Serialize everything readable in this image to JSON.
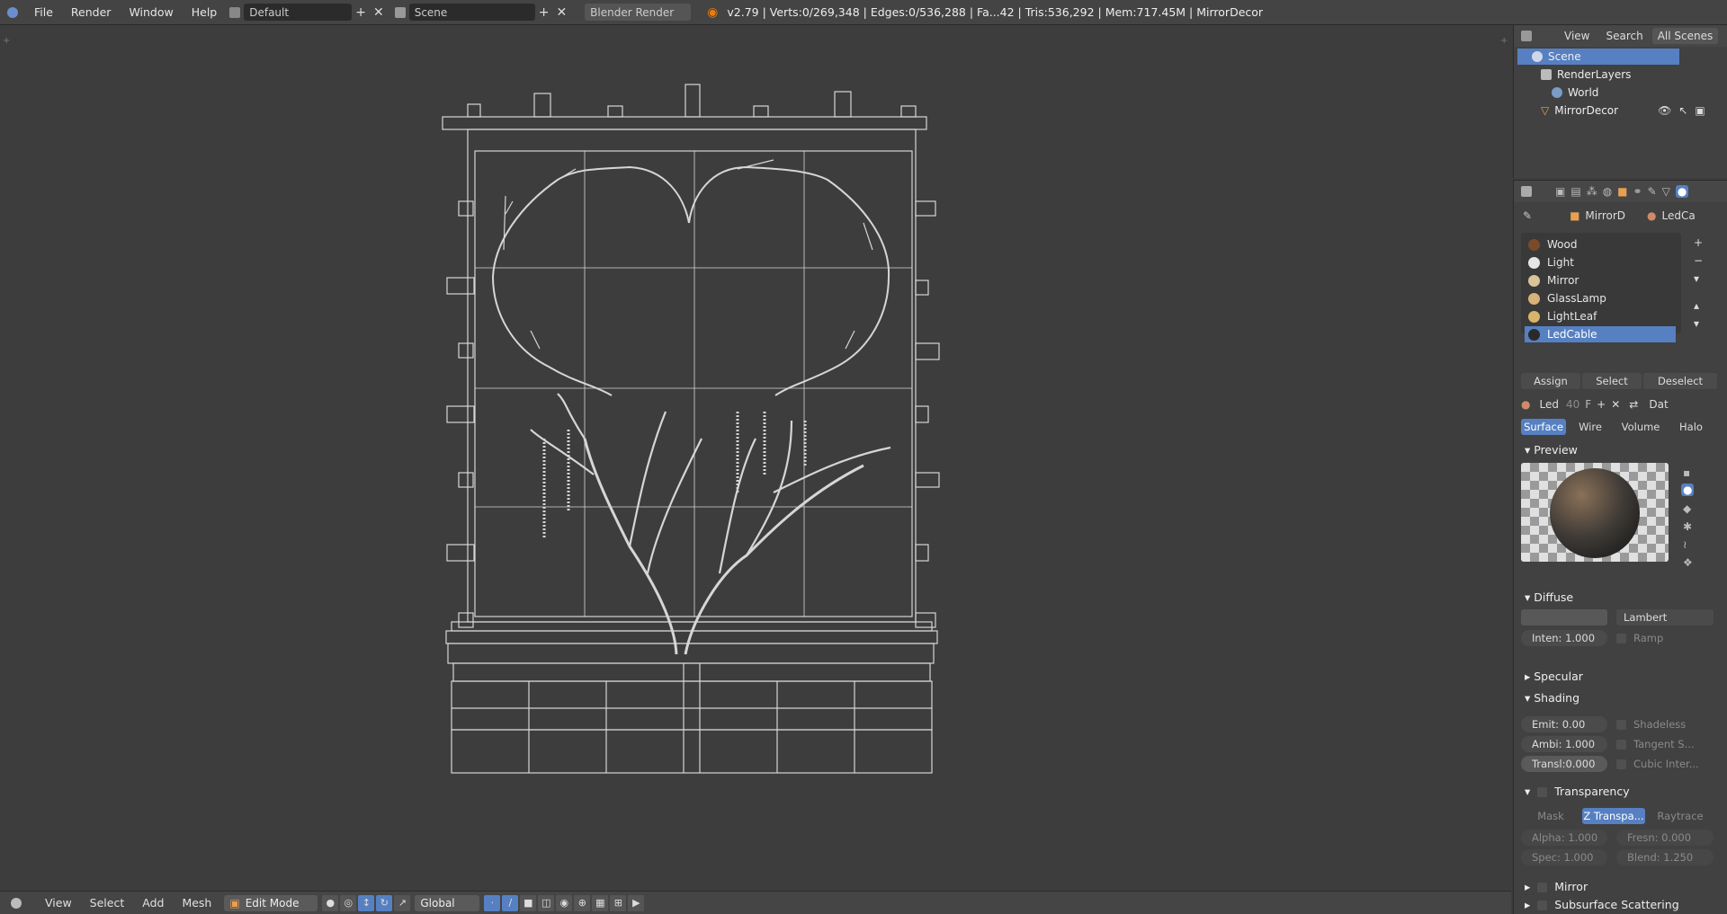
{
  "header": {
    "menus": [
      "File",
      "Render",
      "Window",
      "Help"
    ],
    "screen_layout": "Default",
    "scene": "Scene",
    "render_engine": "Blender Render",
    "stats": "v2.79 | Verts:0/269,348 | Edges:0/536,288 | Fa...42 | Tris:536,292 | Mem:717.45M | MirrorDecor"
  },
  "outliner": {
    "menus": [
      "View",
      "Search",
      "All Scenes"
    ],
    "items": [
      "Scene",
      "RenderLayers",
      "World",
      "MirrorDecor"
    ]
  },
  "properties": {
    "context": [
      "MirrorD",
      "LedCa"
    ],
    "materials": [
      {
        "name": "Wood",
        "color": "#7a4a2a"
      },
      {
        "name": "Light",
        "color": "#e6e6e6"
      },
      {
        "name": "Mirror",
        "color": "#d9c39a"
      },
      {
        "name": "GlassLamp",
        "color": "#d7b37a"
      },
      {
        "name": "LightLeaf",
        "color": "#d9b46a"
      },
      {
        "name": "LedCable",
        "color": "#2a2a2a"
      }
    ],
    "assign_label": "Assign",
    "select_label": "Select",
    "deselect_label": "Deselect",
    "mat_name": "Led",
    "mat_users": "40",
    "mat_fake": "F",
    "mat_data": "Dat",
    "tabs": [
      "Surface",
      "Wire",
      "Volume",
      "Halo"
    ],
    "preview_label": "Preview",
    "diffuse_label": "Diffuse",
    "diffuse_shader": "Lambert",
    "diffuse_intensity": "Inten: 1.000",
    "ramp_label": "Ramp",
    "specular_label": "Specular",
    "shading_label": "Shading",
    "emit": "Emit:  0.00",
    "ambi": "Ambi: 1.000",
    "transl": "Transl:0.000",
    "shadeless": "Shadeless",
    "tangent": "Tangent S...",
    "cubic": "Cubic Inter...",
    "transparency_label": "Transparency",
    "trans_modes": [
      "Mask",
      "Z Transpa...",
      "Raytrace"
    ],
    "alpha": "Alpha: 1.000",
    "fresnel": "Fresn: 0.000",
    "spec": "Spec:  1.000",
    "blend": "Blend: 1.250",
    "mirror_label": "Mirror",
    "sss_label": "Subsurface Scattering"
  },
  "bottombar": {
    "menus": [
      "View",
      "Select",
      "Add",
      "Mesh"
    ],
    "mode": "Edit Mode",
    "orientation": "Global"
  }
}
